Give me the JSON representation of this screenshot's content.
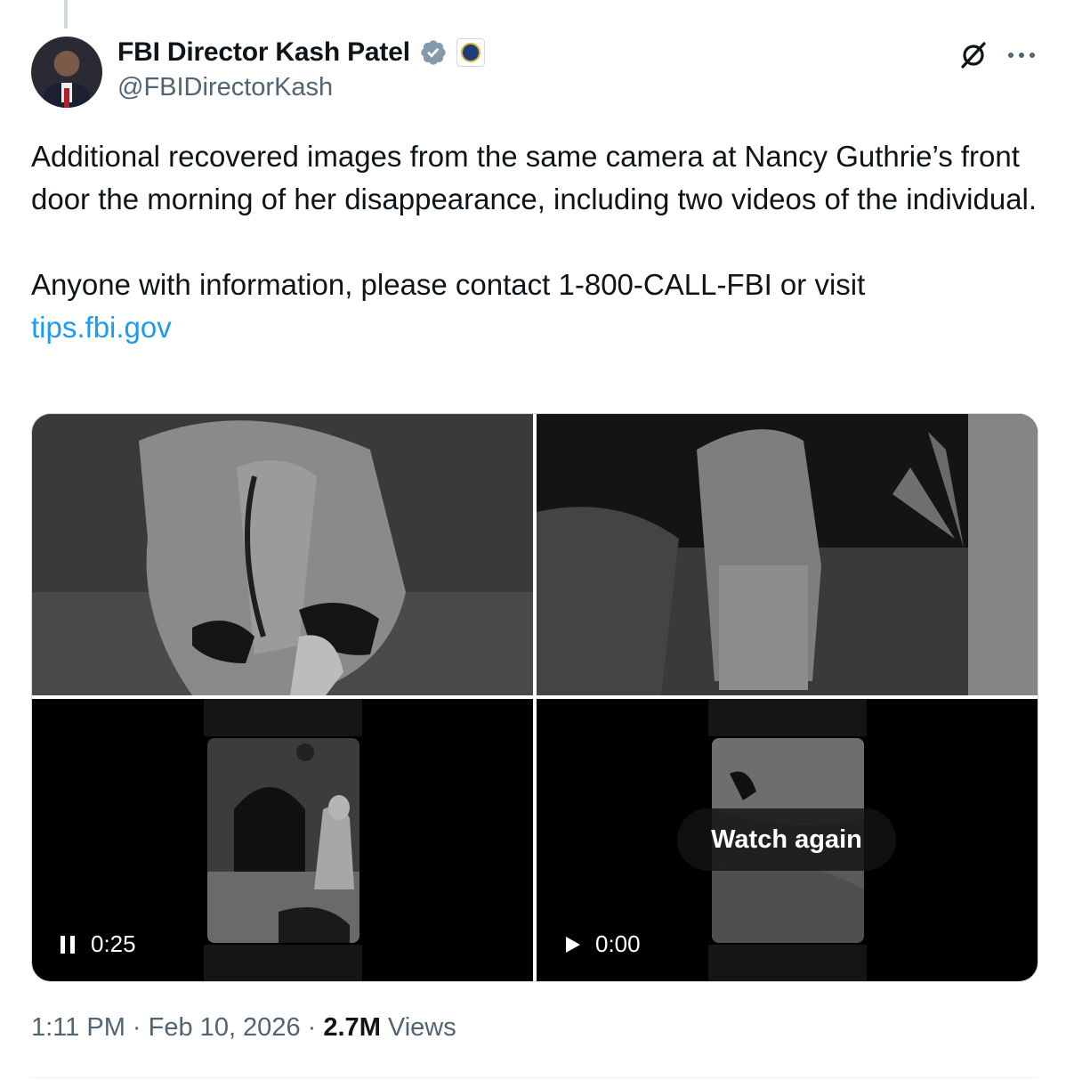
{
  "author": {
    "display_name": "FBI Director Kash Patel",
    "handle": "@FBIDirectorKash",
    "verified": true,
    "affiliation_badge_icon": "fbi-seal-icon"
  },
  "tweet": {
    "paragraph1": "Additional recovered images from the same camera at Nancy Guthrie’s front door the morning of her disappearance, including two videos of the individual.",
    "paragraph2_prefix": "Anyone with information, please contact 1-800-CALL-FBI or visit",
    "link_text": "tips.fbi.gov"
  },
  "media": {
    "video1": {
      "state": "playing",
      "time": "0:25",
      "icon": "pause-icon"
    },
    "video2": {
      "state": "ended",
      "time": "0:00",
      "icon": "play-icon",
      "overlay_label": "Watch again"
    }
  },
  "meta": {
    "time": "1:11 PM",
    "separator": "·",
    "date": "Feb 10, 2026",
    "views_count": "2.7M",
    "views_label": "Views"
  },
  "colors": {
    "link": "#1d9bf0",
    "secondary_text": "#536471",
    "verified_badge": "#829aab"
  }
}
